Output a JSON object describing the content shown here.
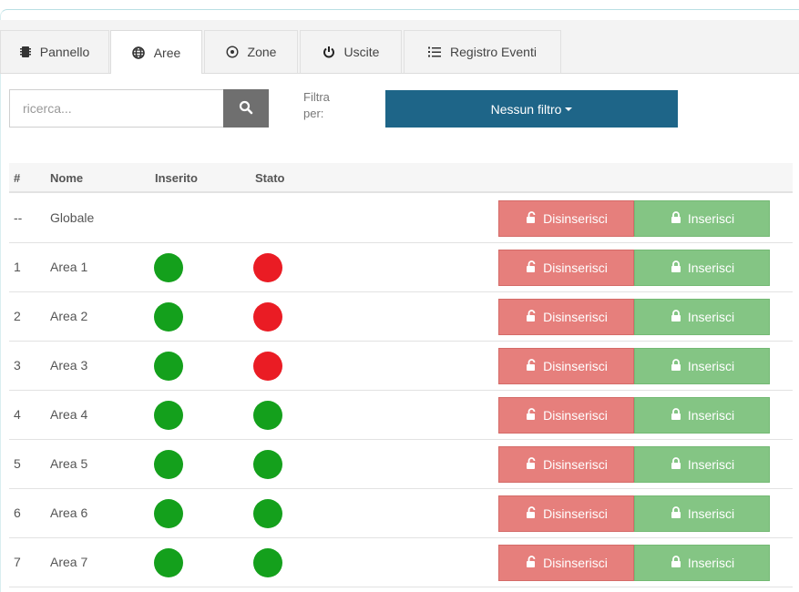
{
  "tabs": [
    {
      "label": "Pannello",
      "icon": "chip-icon",
      "active": false
    },
    {
      "label": "Aree",
      "icon": "globe-icon",
      "active": true
    },
    {
      "label": "Zone",
      "icon": "radio-target-icon",
      "active": false
    },
    {
      "label": "Uscite",
      "icon": "power-icon",
      "active": false
    },
    {
      "label": "Registro Eventi",
      "icon": "list-icon",
      "active": false
    }
  ],
  "search": {
    "placeholder": "ricerca...",
    "button_icon": "search-icon"
  },
  "filter": {
    "label": "Filtra per:",
    "button_label": "Nessun filtro"
  },
  "table": {
    "headers": {
      "num": "#",
      "name": "Nome",
      "armed": "Inserito",
      "status": "Stato"
    },
    "global": {
      "num": "--",
      "name": "Globale"
    },
    "disarm_label": "Disinserisci",
    "arm_label": "Inserisci",
    "rows": [
      {
        "num": "1",
        "name": "Area 1",
        "armed": "green",
        "status": "red"
      },
      {
        "num": "2",
        "name": "Area 2",
        "armed": "green",
        "status": "red"
      },
      {
        "num": "3",
        "name": "Area 3",
        "armed": "green",
        "status": "red"
      },
      {
        "num": "4",
        "name": "Area 4",
        "armed": "green",
        "status": "green"
      },
      {
        "num": "5",
        "name": "Area 5",
        "armed": "green",
        "status": "green"
      },
      {
        "num": "6",
        "name": "Area 6",
        "armed": "green",
        "status": "green"
      },
      {
        "num": "7",
        "name": "Area 7",
        "armed": "green",
        "status": "green"
      }
    ]
  },
  "colors": {
    "green": "#14a01c",
    "red": "#ea1c24",
    "primary": "#1e6588",
    "danger": "#e67f7c",
    "success": "#84c584"
  }
}
